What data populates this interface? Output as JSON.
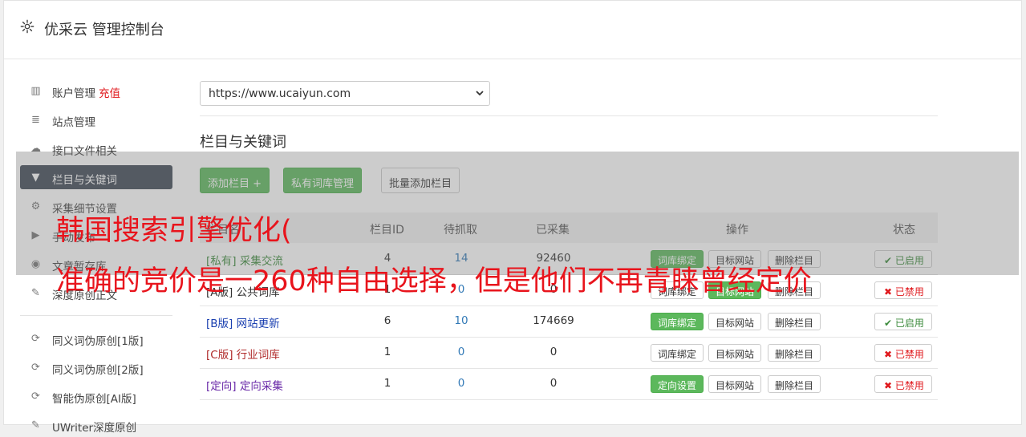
{
  "header": {
    "title": "优采云 管理控制台"
  },
  "sidebar": {
    "items": [
      {
        "label": "账户管理",
        "extra": "充值",
        "icon": "bar-chart-icon"
      },
      {
        "label": "站点管理",
        "icon": "server-icon"
      },
      {
        "label": "接口文件相关",
        "icon": "cloud-upload-icon"
      },
      {
        "label": "栏目与关键词",
        "icon": "filter-icon",
        "active": true
      },
      {
        "label": "采集细节设置",
        "icon": "cogs-icon"
      },
      {
        "label": "手动发布",
        "icon": "play-circle-icon"
      },
      {
        "label": "文章暂存库",
        "icon": "database-icon"
      },
      {
        "label": "深度原创正文",
        "icon": "edit-icon"
      }
    ],
    "items2": [
      {
        "label": "同义词伪原创[1版]",
        "icon": "refresh-icon"
      },
      {
        "label": "同义词伪原创[2版]",
        "icon": "refresh-icon"
      },
      {
        "label": "智能伪原创[AI版]",
        "icon": "refresh-icon"
      },
      {
        "label": "UWriter深度原创",
        "icon": "edit-icon"
      }
    ]
  },
  "site_select": {
    "value": "https://www.ucaiyun.com"
  },
  "section": {
    "title": "栏目与关键词",
    "buttons": {
      "add": "添加栏目 +",
      "private_lib": "私有词库管理",
      "batch_add": "批量添加栏目"
    }
  },
  "table": {
    "headers": [
      "栏目名",
      "栏目ID",
      "待抓取",
      "已采集",
      "操作",
      "状态"
    ],
    "rows": [
      {
        "type": "[私有]",
        "name": "采集交流",
        "type_color": "#3c8b3c",
        "id": "4",
        "pending": "14",
        "collected": "92460",
        "op1": "词库绑定",
        "op1_active": true,
        "op2": "目标网站",
        "op3": "删除栏目",
        "status": "已启用",
        "on": true
      },
      {
        "type": "[A版]",
        "name": "公共词库",
        "type_color": "#333333",
        "id": "1",
        "pending": "0",
        "collected": "0",
        "op1": "词库绑定",
        "op1_active": false,
        "op2": "目标网站",
        "op2_active": true,
        "op3": "删除栏目",
        "status": "已禁用",
        "on": false
      },
      {
        "type": "[B版]",
        "name": "网站更新",
        "type_color": "#1a3fb0",
        "id": "6",
        "pending": "10",
        "collected": "174669",
        "op1": "词库绑定",
        "op1_active": true,
        "op2": "目标网站",
        "op3": "删除栏目",
        "status": "已启用",
        "on": true
      },
      {
        "type": "[C版]",
        "name": "行业词库",
        "type_color": "#b02a2a",
        "id": "1",
        "pending": "0",
        "collected": "0",
        "op1": "词库绑定",
        "op1_active": false,
        "op2": "目标网站",
        "op3": "删除栏目",
        "status": "已禁用",
        "on": false
      },
      {
        "type": "[定向]",
        "name": "定向采集",
        "type_color": "#6a2aa8",
        "id": "1",
        "pending": "0",
        "collected": "0",
        "op1": "定向设置",
        "op1_active": true,
        "op2": "目标网站",
        "op3": "删除栏目",
        "status": "已禁用",
        "on": false
      }
    ]
  },
  "overlay": {
    "line1": "韩国搜索引擎优化(",
    "line2": "准确的竞价是一260种自由选择，但是他们不再青睐曾经定价"
  },
  "colors": {
    "accent_green": "#5cb85c",
    "sidebar_active": "#3e4755",
    "danger": "#e0191d",
    "link_blue": "#337ab7"
  }
}
